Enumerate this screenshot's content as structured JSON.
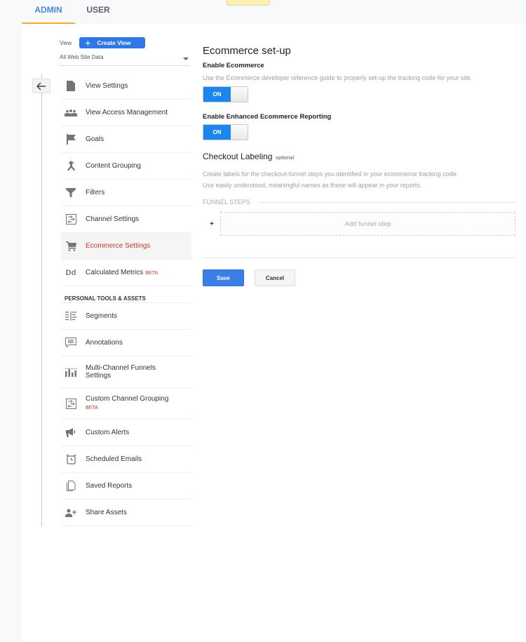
{
  "tabs": [
    {
      "label": "ADMIN",
      "active": true
    },
    {
      "label": "USER",
      "active": false
    }
  ],
  "view": {
    "label": "View",
    "create_button": "Create View",
    "selected": "All Web Site Data"
  },
  "nav": {
    "view_items": [
      {
        "label": "View Settings",
        "icon": "document-icon"
      },
      {
        "label": "View Access Management",
        "icon": "people-icon"
      },
      {
        "label": "Goals",
        "icon": "flag-icon"
      },
      {
        "label": "Content Grouping",
        "icon": "merge-icon"
      },
      {
        "label": "Filters",
        "icon": "filter-icon"
      },
      {
        "label": "Channel Settings",
        "icon": "channel-icon"
      },
      {
        "label": "Ecommerce Settings",
        "icon": "cart-icon",
        "active": true
      },
      {
        "label": "Calculated Metrics",
        "icon": "dd-icon",
        "badge": "BETA"
      }
    ],
    "section_title": "PERSONAL TOOLS & ASSETS",
    "personal_items": [
      {
        "label": "Segments",
        "icon": "segments-icon"
      },
      {
        "label": "Annotations",
        "icon": "comment-icon"
      },
      {
        "label": "Multi-Channel Funnels Settings",
        "icon": "bar-chart-icon"
      },
      {
        "label": "Custom Channel Grouping",
        "icon": "channel-icon",
        "badge": "BETA"
      },
      {
        "label": "Custom Alerts",
        "icon": "megaphone-icon"
      },
      {
        "label": "Scheduled Emails",
        "icon": "alarm-icon"
      },
      {
        "label": "Saved Reports",
        "icon": "copy-icon"
      },
      {
        "label": "Share Assets",
        "icon": "person-add-icon"
      }
    ]
  },
  "content": {
    "title": "Ecommerce set-up",
    "enable_ecommerce": {
      "label": "Enable Ecommerce",
      "description": "Use the Ecommerce developer reference guide to properly set-up the tracking code for your site.",
      "toggle": "ON"
    },
    "enable_enhanced": {
      "label": "Enable Enhanced Ecommerce Reporting",
      "toggle": "ON"
    },
    "checkout": {
      "title": "Checkout Labeling",
      "optional": "optional",
      "description_1": "Create labels for the checkout-funnel steps you identified in your ecommerce tracking code.",
      "description_2": "Use easily understood, meaningful names as these will appear in your reports."
    },
    "funnel": {
      "heading": "FUNNEL STEPS",
      "plus": "+",
      "add_step": "Add funnel step"
    },
    "buttons": {
      "save": "Save",
      "cancel": "Cancel"
    }
  },
  "colors": {
    "accent_blue": "#2e77e8",
    "toggle_blue": "#1a86ee",
    "active_red": "#c5372c",
    "tab_underline": "#f4a83a"
  }
}
